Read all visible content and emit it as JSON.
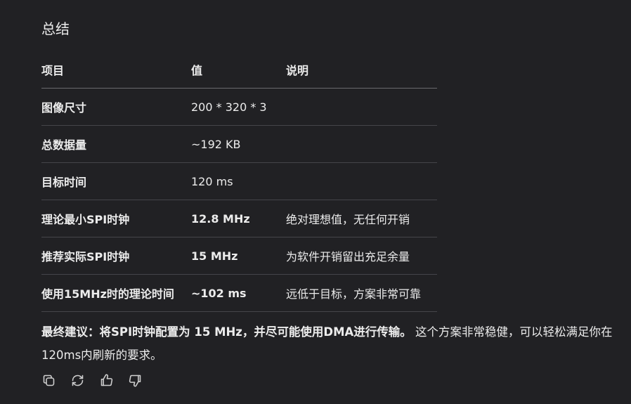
{
  "heading": "总结",
  "table": {
    "headers": [
      "项目",
      "值",
      "说明"
    ],
    "rows": [
      {
        "item": "图像尺寸",
        "value": "200 * 320 * 3",
        "note": "",
        "value_bold": false
      },
      {
        "item": "总数据量",
        "value": "~192 KB",
        "note": "",
        "value_bold": false
      },
      {
        "item": "目标时间",
        "value": "120 ms",
        "note": "",
        "value_bold": false
      },
      {
        "item": "理论最小SPI时钟",
        "value": "12.8 MHz",
        "note": "绝对理想值，无任何开销",
        "value_bold": true
      },
      {
        "item": "推荐实际SPI时钟",
        "value": "15 MHz",
        "note": "为软件开销留出充足余量",
        "value_bold": true
      },
      {
        "item": "使用15MHz时的理论时间",
        "value": "~102 ms",
        "note": "远低于目标，方案非常可靠",
        "value_bold": true
      }
    ]
  },
  "advice": {
    "bold": "最终建议：将SPI时钟配置为 15 MHz，并尽可能使用DMA进行传输。",
    "rest": " 这个方案非常稳健，可以轻松满足你在120ms内刷新的要求。"
  },
  "actions": [
    {
      "name": "copy-icon"
    },
    {
      "name": "regenerate-icon"
    },
    {
      "name": "thumbs-up-icon"
    },
    {
      "name": "thumbs-down-icon"
    }
  ],
  "colors": {
    "background": "#212124",
    "text": "#ececec",
    "divider": "#45454a"
  }
}
